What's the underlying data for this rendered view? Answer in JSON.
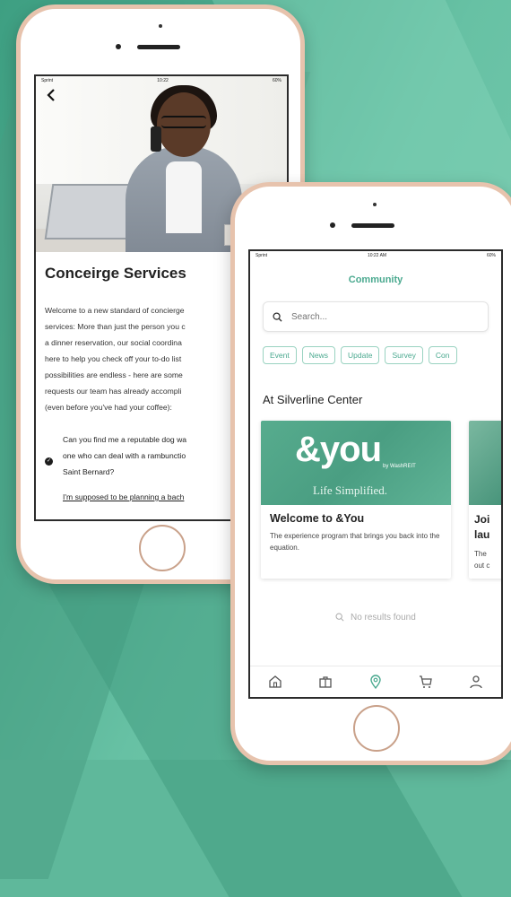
{
  "colors": {
    "accent": "#4aa98f",
    "background": "#5fb89b",
    "frame": "#e7c3ad"
  },
  "phone1": {
    "status": {
      "carrier": "Sprint",
      "time": "10:22",
      "battery": "60%"
    },
    "title": "Conceirge Services",
    "body_lines": [
      "Welcome to a new standard of concierge",
      "services: More than just the person you c",
      "a dinner reservation, our social coordina",
      "here to help you check off your to-do list",
      "possibilities are endless - here are some",
      "requests our team has already accompli",
      "(even before you've had your coffee):"
    ],
    "question1_lines": [
      "Can you find me a reputable dog wa",
      "one who can deal with a rambunctio",
      "Saint Bernard?"
    ],
    "question2": "I'm supposed to be planning a bach"
  },
  "phone2": {
    "status": {
      "carrier": "Sprint",
      "time": "10:22 AM",
      "battery": "60%"
    },
    "title": "Community",
    "search_placeholder": "Search...",
    "chips": [
      "Event",
      "News",
      "Update",
      "Survey",
      "Con"
    ],
    "section_title": "At Silverline Center",
    "card1": {
      "brand": "&you",
      "byline": "by WashREIT",
      "tagline": "Life Simplified.",
      "title": "Welcome to &You",
      "description": "The experience program that brings you back into the equation."
    },
    "card2": {
      "title_lines": [
        "Joi",
        "lau"
      ],
      "desc_lines": [
        "The",
        "out c"
      ]
    },
    "no_results": "No results found",
    "tabbar_icons": [
      "home-icon",
      "briefcase-icon",
      "location-pin-icon",
      "cart-icon",
      "user-icon"
    ]
  }
}
